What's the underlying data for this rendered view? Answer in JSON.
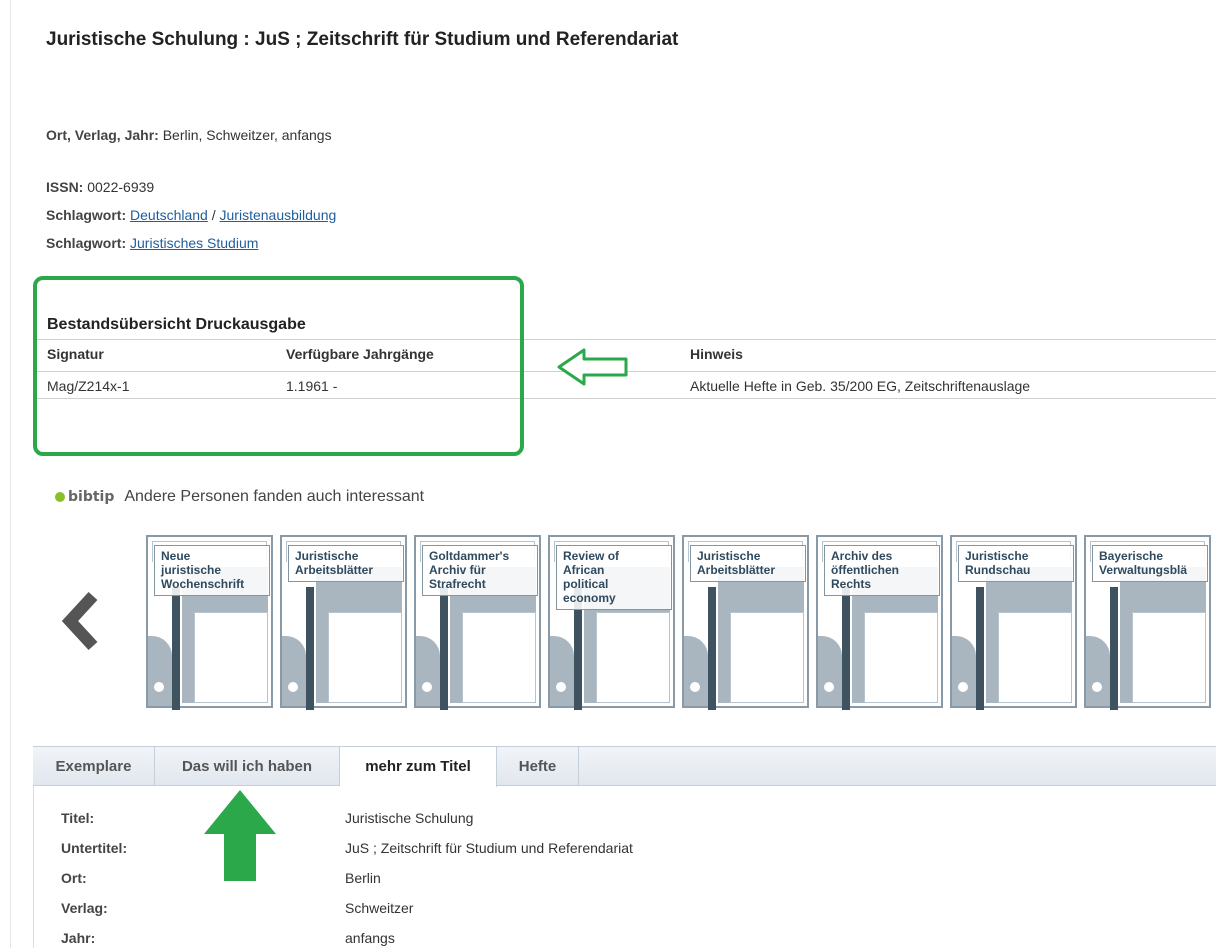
{
  "record": {
    "title": "Juristische Schulung : JuS ; Zeitschrift für Studium und Referendariat",
    "ort_verlag_jahr_label": "Ort, Verlag, Jahr:",
    "ort_verlag_jahr_value": " Berlin, Schweitzer, anfangs",
    "issn_label": "ISSN:",
    "issn_value": " 0022-6939",
    "subjects": [
      {
        "label": "Schlagwort:",
        "links": [
          "Deutschland",
          "Juristenausbildung"
        ],
        "separator": " / "
      },
      {
        "label": "Schlagwort:",
        "links": [
          "Juristisches Studium"
        ]
      }
    ]
  },
  "holdings": {
    "title": "Bestandsübersicht Druckausgabe",
    "headers": [
      "Signatur",
      "Verfügbare Jahrgänge",
      "Hinweis"
    ],
    "rows": [
      [
        "Mag/Z214x-1",
        "1.1961 -",
        "Aktuelle Hefte in Geb. 35/200 EG, Zeitschriftenauslage"
      ]
    ]
  },
  "annotations": {
    "color": "#2aa84a",
    "shapes": [
      "outline-box",
      "arrow-left-icon",
      "arrow-up-icon"
    ]
  },
  "recommendations": {
    "logo_text": "bibtip",
    "heading": "Andere Personen fanden auch interessant",
    "prev_icon": "chevron-left-icon",
    "items": [
      "Neue\njuristische\nWochenschrift",
      "Juristische\nArbeitsblätter",
      "Goltdammer's\nArchiv für\nStrafrecht",
      "Review of\nAfrican\npolitical\neconomy",
      "Juristische\nArbeitsblätter",
      "Archiv des\nöffentlichen\nRechts",
      "Juristische\nRundschau",
      "Bayerische\nVerwaltungsblä"
    ]
  },
  "tabs": {
    "items": [
      "Exemplare",
      "Das will ich haben",
      "mehr zum Titel",
      "Hefte"
    ],
    "active": "mehr zum Titel"
  },
  "details": [
    {
      "key": "Titel:",
      "value": "Juristische Schulung"
    },
    {
      "key": "Untertitel:",
      "value": "JuS ; Zeitschrift für Studium und Referendariat"
    },
    {
      "key": "Ort:",
      "value": "Berlin"
    },
    {
      "key": "Verlag:",
      "value": "Schweitzer"
    },
    {
      "key": "Jahr:",
      "value": "anfangs"
    }
  ]
}
